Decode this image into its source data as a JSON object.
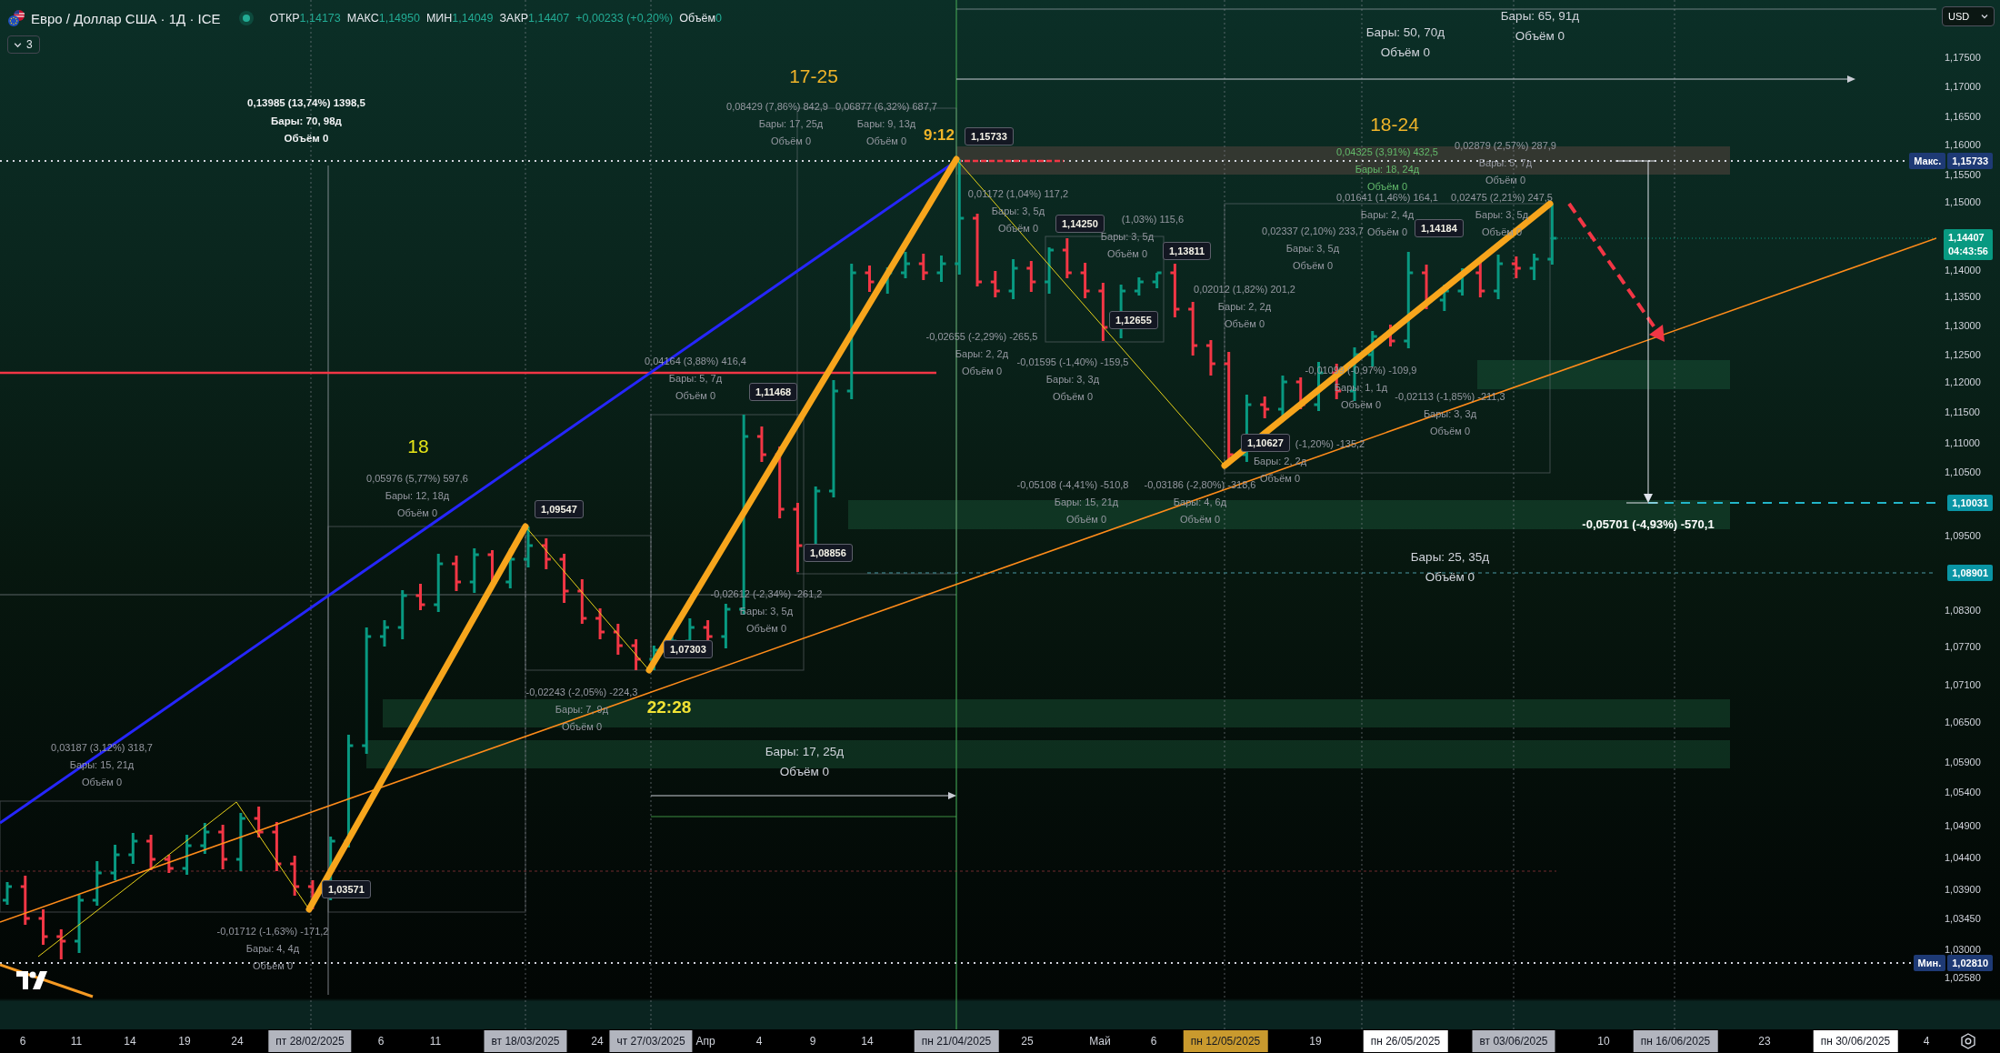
{
  "legend": {
    "symbol": "Евро / Доллар США · 1Д · ICE",
    "ohlc": [
      {
        "label": "ОТКР",
        "value": "1,14173"
      },
      {
        "label": "МАКС",
        "value": "1,14950"
      },
      {
        "label": "МИН",
        "value": "1,14049"
      },
      {
        "label": "ЗАКР",
        "value": "1,14407"
      }
    ],
    "change": "+0,00233 (+0,20%)",
    "volume": {
      "label": "Объём",
      "value": "0"
    },
    "indicators_toggle": "3"
  },
  "price_axis": {
    "currency": "USD",
    "ticks": [
      "1,17500",
      "1,17000",
      "1,16500",
      "1,16000",
      "1,15500",
      "1,15000",
      "1,14000",
      "1,13500",
      "1,13000",
      "1,12500",
      "1,12000",
      "1,11500",
      "1,11000",
      "1,10500",
      "1,09500",
      "1,08300",
      "1,07700",
      "1,07100",
      "1,06500",
      "1,05900",
      "1,05400",
      "1,04900",
      "1,04400",
      "1,03900",
      "1,03450",
      "1,03000",
      "1,02580"
    ],
    "markers": [
      {
        "kind": "max",
        "label": "Макс.",
        "value": "1,15733"
      },
      {
        "kind": "last",
        "value": "1,14407",
        "countdown": "04:43:56"
      },
      {
        "kind": "level",
        "value": "1,10031"
      },
      {
        "kind": "level",
        "value": "1,08901"
      },
      {
        "kind": "min",
        "label": "Мин.",
        "value": "1,02810"
      }
    ]
  },
  "chart": {
    "wave_labels": [
      {
        "text": "17-25",
        "color": "#f0b429"
      },
      {
        "text": "18-24",
        "color": "#f0b429"
      },
      {
        "text": "9:12",
        "color": "#f0b429"
      },
      {
        "text": "18",
        "color": "#e6e617"
      },
      {
        "text": "22:28",
        "color": "#f2e234"
      }
    ],
    "price_callouts": [
      "1,15733",
      "1,14250",
      "1,14184",
      "1,13811",
      "1,12655",
      "1,11468",
      "1,10627",
      "1,09547",
      "1,08856",
      "1,07303",
      "1,03571"
    ],
    "measurements": [
      {
        "kind": "large",
        "bars": "Бары: 65, 91д",
        "volume": "Объём 0"
      },
      {
        "kind": "large",
        "bars": "Бары: 50, 70д",
        "volume": "Объём 0"
      },
      {
        "kind": "bright",
        "range": "0,13985 (13,74%) 1398,5",
        "bars": "Бары: 70, 98д",
        "volume": "Объём 0"
      },
      {
        "kind": "plain",
        "range": "0,08429 (7,86%) 842,9",
        "bars": "Бары: 17, 25д",
        "volume": "Объём 0"
      },
      {
        "kind": "plain",
        "range": "0,06877 (6,32%) 687,7",
        "bars": "Бары: 9, 13д",
        "volume": "Объём 0"
      },
      {
        "kind": "plain",
        "range": "0,02879 (2,57%) 287,9",
        "bars": "Бары: 5, 7д",
        "volume": "Объём 0"
      },
      {
        "kind": "green",
        "range": "0,04325 (3,91%) 432,5",
        "bars": "Бары: 18, 24д",
        "volume": "Объём 0"
      },
      {
        "kind": "plain",
        "range": "0,01172 (1,04%) 117,2",
        "bars": "Бары: 3, 5д",
        "volume": "Объём 0"
      },
      {
        "kind": "plain",
        "range": "0,01641 (1,46%) 164,1",
        "bars": "Бары: 2, 4д",
        "volume": "Объём 0"
      },
      {
        "kind": "plain",
        "range": "0,02475 (2,21%) 247,5",
        "bars": "Бары: 3, 5д",
        "volume": "Объём 0"
      },
      {
        "kind": "plain",
        "range": "(1,03%) 115,6",
        "bars": "Бары: 3, 5д",
        "volume": "Объём 0"
      },
      {
        "kind": "plain",
        "range": "0,02337 (2,10%) 233,7",
        "bars": "Бары: 3, 5д",
        "volume": "Объём 0"
      },
      {
        "kind": "plain",
        "range": "0,02012 (1,82%) 201,2",
        "bars": "Бары: 2, 2д",
        "volume": "Объём 0"
      },
      {
        "kind": "plain",
        "range": "-0,02655 (-2,29%) -265,5",
        "bars": "Бары: 2, 2д",
        "volume": "Объём 0"
      },
      {
        "kind": "plain",
        "range": "0,04164 (3,88%) 416,4",
        "bars": "Бары: 5, 7д",
        "volume": "Объём 0"
      },
      {
        "kind": "plain",
        "range": "-0,01595 (-1,40%) -159,5",
        "bars": "Бары: 3, 3д",
        "volume": "Объём 0"
      },
      {
        "kind": "plain",
        "range": "-0,01099 (-0,97%) -109,9",
        "bars": "Бары: 1, 1д",
        "volume": "Объём 0"
      },
      {
        "kind": "plain",
        "range": "-0,02113 (-1,85%) -211,3",
        "bars": "Бары: 3, 3д",
        "volume": "Объём 0"
      },
      {
        "kind": "plain",
        "range": "(-1,20%) -135,2",
        "bars": "Бары: 2, 2д",
        "volume": "Объём 0"
      },
      {
        "kind": "plain",
        "range": "0,05976 (5,77%) 597,6",
        "bars": "Бары: 12, 18д",
        "volume": "Объём 0"
      },
      {
        "kind": "plain",
        "range": "-0,05108 (-4,41%) -510,8",
        "bars": "Бары: 15, 21д",
        "volume": "Объём 0"
      },
      {
        "kind": "plain",
        "range": "-0,03186 (-2,80%) -318,6",
        "bars": "Бары: 4, 6д",
        "volume": "Объём 0"
      },
      {
        "kind": "bold",
        "range": "-0,05701 (-4,93%) -570,1"
      },
      {
        "kind": "large",
        "bars": "Бары: 25, 35д",
        "volume": "Объём 0"
      },
      {
        "kind": "plain",
        "range": "-0,02612 (-2,34%) -261,2",
        "bars": "Бары: 3, 5д",
        "volume": "Объём 0"
      },
      {
        "kind": "plain",
        "range": "-0,02243 (-2,05%) -224,3",
        "bars": "Бары: 7, 9д",
        "volume": "Объём 0"
      },
      {
        "kind": "plain",
        "range": "0,03187 (3,12%) 318,7",
        "bars": "Бары: 15, 21д",
        "volume": "Объём 0"
      },
      {
        "kind": "large",
        "bars": "Бары: 17, 25д",
        "volume": "Объём 0"
      },
      {
        "kind": "plain",
        "range": "-0,01712 (-1,63%) -171,2",
        "bars": "Бары: 4, 4д",
        "volume": "Объём 0"
      }
    ]
  },
  "time_axis": {
    "labels": [
      {
        "text": "6",
        "kind": "tick"
      },
      {
        "text": "11",
        "kind": "tick"
      },
      {
        "text": "14",
        "kind": "tick"
      },
      {
        "text": "19",
        "kind": "tick"
      },
      {
        "text": "24",
        "kind": "tick"
      },
      {
        "text": "пт 28/02/2025",
        "kind": "marker",
        "color": "#b2b5be"
      },
      {
        "text": "6",
        "kind": "tick"
      },
      {
        "text": "11",
        "kind": "tick"
      },
      {
        "text": "вт 18/03/2025",
        "kind": "marker",
        "color": "#b2b5be"
      },
      {
        "text": "24",
        "kind": "tick"
      },
      {
        "text": "чт 27/03/2025",
        "kind": "marker",
        "color": "#b2b5be"
      },
      {
        "text": "Апр",
        "kind": "tick"
      },
      {
        "text": "4",
        "kind": "tick"
      },
      {
        "text": "9",
        "kind": "tick"
      },
      {
        "text": "14",
        "kind": "tick"
      },
      {
        "text": "пн 21/04/2025",
        "kind": "marker",
        "color": "#b2b5be"
      },
      {
        "text": "25",
        "kind": "tick"
      },
      {
        "text": "Май",
        "kind": "tick"
      },
      {
        "text": "6",
        "kind": "tick"
      },
      {
        "text": "пн 12/05/2025",
        "kind": "marker",
        "color": "#c99a2e"
      },
      {
        "text": "19",
        "kind": "tick"
      },
      {
        "text": "пн 26/05/2025",
        "kind": "marker",
        "color": "#ffffff"
      },
      {
        "text": "вт 03/06/2025",
        "kind": "marker",
        "color": "#b2b5be"
      },
      {
        "text": "10",
        "kind": "tick"
      },
      {
        "text": "пн 16/06/2025",
        "kind": "marker",
        "color": "#b2b5be"
      },
      {
        "text": "23",
        "kind": "tick"
      },
      {
        "text": "пн 30/06/2025",
        "kind": "marker",
        "color": "#ffffff"
      },
      {
        "text": "4",
        "kind": "tick"
      }
    ]
  }
}
